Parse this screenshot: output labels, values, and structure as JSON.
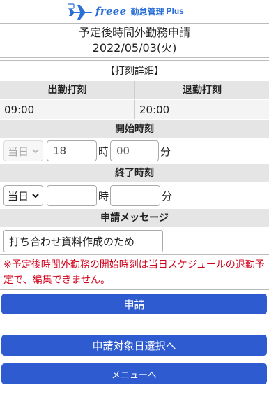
{
  "header": {
    "brand": "freee",
    "product": "勤怠管理",
    "plus": "Plus"
  },
  "page": {
    "title": "予定後時間外勤務申請",
    "date": "2022/05/03(火)"
  },
  "punch_detail": {
    "heading": "【打刻詳細】",
    "in_label": "出勤打刻",
    "out_label": "退勤打刻",
    "in_value": "09:00",
    "out_value": "20:00"
  },
  "start_time": {
    "heading": "開始時刻",
    "day_select": "当日",
    "hour_value": "18",
    "hour_unit": "時",
    "minute_placeholder": "00",
    "minute_unit": "分"
  },
  "end_time": {
    "heading": "終了時刻",
    "day_select": "当日",
    "hour_value": "",
    "hour_unit": "時",
    "minute_value": "",
    "minute_unit": "分"
  },
  "message": {
    "heading": "申請メッセージ",
    "value": "打ち合わせ資料作成のため"
  },
  "warning": "※予定後時間外勤務の開始時刻は当日スケジュールの退勤予定で、編集できません。",
  "buttons": {
    "submit": "申請",
    "select_date": "申請対象日選択へ",
    "menu": "メニューへ"
  },
  "colors": {
    "accent": "#2f5bd1",
    "brand": "#2a6fd6",
    "warning": "#d0021b",
    "section_bg": "#e5e5e5"
  }
}
